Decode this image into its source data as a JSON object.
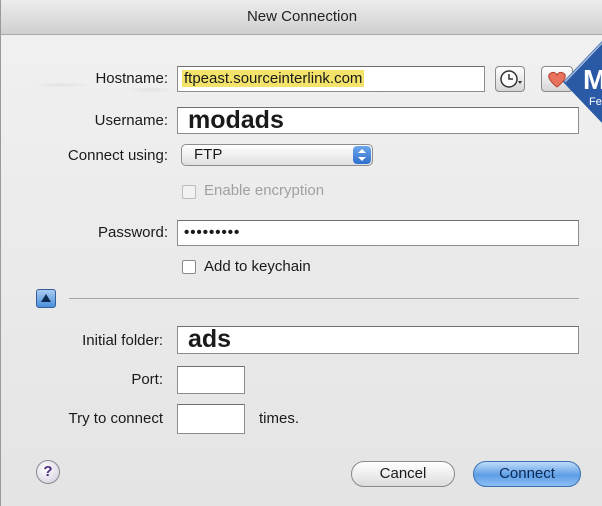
{
  "window": {
    "title": "New Connection"
  },
  "form": {
    "hostname_label": "Hostname:",
    "hostname_value": "ftpeast.sourceinterlink.com",
    "username_label": "Username:",
    "username_value": "modads",
    "connect_using_label": "Connect using:",
    "connect_using_value": "FTP",
    "enable_encryption_label": "Enable encryption",
    "password_label": "Password:",
    "password_value": "•••••••••",
    "add_to_keychain_label": "Add to keychain",
    "initial_folder_label": "Initial folder:",
    "initial_folder_value": "ads",
    "port_label": "Port:",
    "port_value": "",
    "try_label": "Try to connect",
    "try_value": "",
    "times_label": "times."
  },
  "buttons": {
    "cancel": "Cancel",
    "connect": "Connect",
    "help": "?"
  },
  "badge": {
    "letter": "M",
    "sub": "Fe"
  },
  "colors": {
    "accent": "#4b8fdc",
    "highlight": "#f4e36a",
    "badge": "#2a5aa6"
  }
}
